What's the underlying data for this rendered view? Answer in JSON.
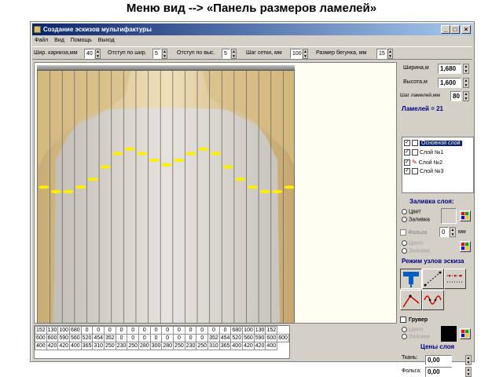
{
  "caption": "Меню вид --> «Панель размеров ламелей»",
  "window": {
    "title": "Создание эскизов мультифактуры",
    "min": "_",
    "max": "□",
    "close": "×"
  },
  "menu": [
    "Файл",
    "Вид",
    "Помощь",
    "Выход"
  ],
  "toolbar": [
    {
      "label": "Шир. карниза,мм",
      "value": "40"
    },
    {
      "label": "Отступ по шир.",
      "value": "5"
    },
    {
      "label": "Отступ по выс.",
      "value": "5"
    },
    {
      "label": "Шаг сетки, мм",
      "value": "100"
    },
    {
      "label": "Размер бегунка, мм",
      "value": "15"
    }
  ],
  "grid": [
    [
      "152",
      "130",
      "100",
      "680",
      "0",
      "0",
      "0",
      "0",
      "0",
      "0",
      "0",
      "0",
      "0",
      "0",
      "0",
      "0",
      "0",
      "680",
      "100",
      "130",
      "152"
    ],
    [
      "600",
      "600",
      "590",
      "560",
      "520",
      "454",
      "352",
      "0",
      "0",
      "0",
      "0",
      "0",
      "0",
      "0",
      "0",
      "352",
      "454",
      "520",
      "560",
      "590",
      "600",
      "600"
    ],
    [
      "400",
      "420",
      "420",
      "400",
      "365",
      "310",
      "250",
      "230",
      "250",
      "280",
      "300",
      "280",
      "250",
      "230",
      "250",
      "310",
      "365",
      "400",
      "420",
      "420",
      "400"
    ]
  ],
  "panel": {
    "width_label": "Ширина,м",
    "width_value": "1,680",
    "height_label": "Высота,м",
    "height_value": "1,600",
    "step_label": "Шаг ламелей,мм",
    "step_value": "80",
    "lamels": "Ламелей = 21",
    "layers": [
      {
        "name": "Основной слой",
        "checked": true,
        "selected": true
      },
      {
        "name": "Слой №1",
        "checked": true,
        "selected": false
      },
      {
        "name": "Слой №2",
        "checked": true,
        "selected": false
      },
      {
        "name": "Слой №3",
        "checked": true,
        "selected": false
      }
    ],
    "fill_header": "Заливка слоя:",
    "fill_color": "Цвет",
    "fill_fill": "Заливка",
    "foil_label": "Фольга",
    "foil_value": "0",
    "foil_unit": "мм",
    "foil_color": "Цвет",
    "foil_fill": "Заливка",
    "mode_header": "Режим узлов эскиза",
    "gruver": "Грувер",
    "gruver_color": "Цвет",
    "gruver_fill": "Заливка",
    "prices_header": "Цены слоя",
    "fabric_label": "Ткань:",
    "fabric_value": "0,00",
    "foil_price_label": "Фольга:",
    "foil_price_value": "0,00"
  },
  "colors": {
    "title_bar": "#0a246a",
    "selection": "#0a246a",
    "header_text": "#000080",
    "curtain_gold": "#d9c08a",
    "curtain_grey": "#d6d3cf",
    "marker_yellow": "#ffee00"
  },
  "icons": [
    "app-icon",
    "minimize-icon",
    "maximize-icon",
    "close-icon",
    "palette-icon",
    "pipette-icon",
    "node-line-icon",
    "node-dots-icon",
    "node-red-icon",
    "node-wave-icon"
  ]
}
